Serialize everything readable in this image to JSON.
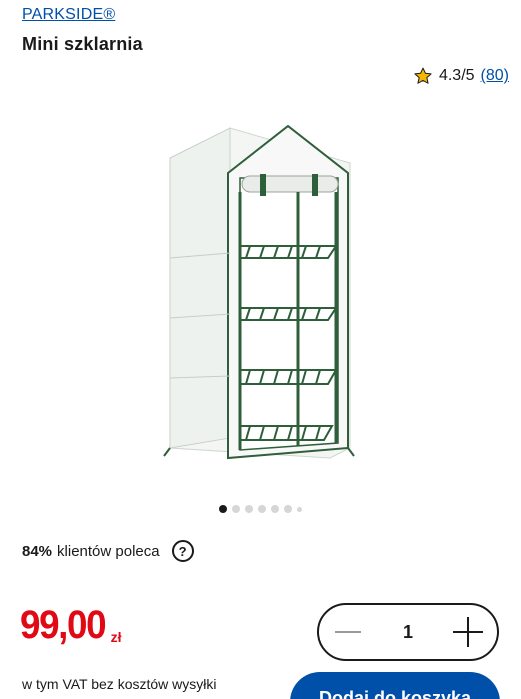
{
  "product": {
    "brand": "PARKSIDE®",
    "title": "Mini szklarnia"
  },
  "rating": {
    "score": "4.3/5",
    "count": "(80)",
    "star_color": "#f5b800"
  },
  "gallery": {
    "image_icon": "greenhouse-image",
    "total_dots": 7,
    "active_index": 0
  },
  "recommend": {
    "percent": "84%",
    "text": "klientów poleca",
    "help_symbol": "?"
  },
  "price": {
    "amount": "99,00",
    "currency": "zł",
    "color": "#e10915"
  },
  "quantity": {
    "value": "1"
  },
  "vat_note": "w tym VAT bez kosztów wysyłki",
  "cart_button": {
    "label": "Dodaj do koszyka",
    "color": "#0050aa"
  }
}
